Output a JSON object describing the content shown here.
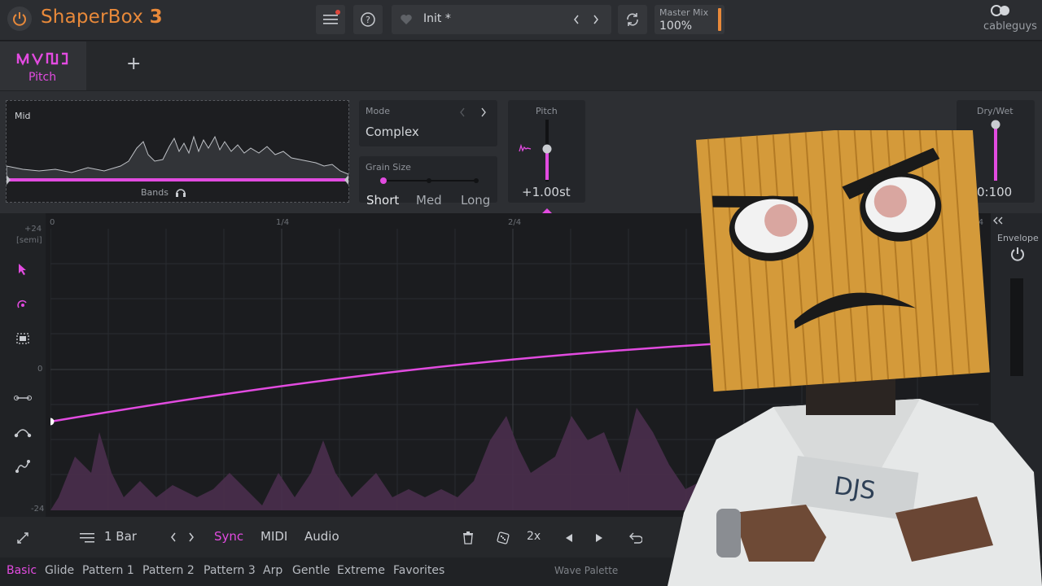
{
  "app": {
    "brand_name": "ShaperBox",
    "brand_version": "3",
    "vendor": "cableguys"
  },
  "topbar": {
    "preset_name": "Init *",
    "master_mix_label": "Master Mix",
    "master_mix_value": "100%"
  },
  "tabs": [
    {
      "label": "Pitch",
      "active": true
    }
  ],
  "analyzer": {
    "label": "Mid",
    "bands_label": "Bands"
  },
  "mode": {
    "label": "Mode",
    "value": "Complex"
  },
  "grain_size": {
    "label": "Grain Size",
    "options": [
      "Short",
      "Med",
      "Long"
    ],
    "selected": "Short"
  },
  "pitch": {
    "label": "Pitch",
    "value": "+1.00st",
    "level": 0.52
  },
  "dry_wet": {
    "label": "Dry/Wet",
    "value": "0:100",
    "level": 1.0
  },
  "editor": {
    "y_labels": [
      "+24",
      "[semi]",
      "0",
      "-24"
    ],
    "x_labels": [
      "0",
      "1/4",
      "2/4",
      "4/4"
    ],
    "envelope_label": "Envelope"
  },
  "bottombar": {
    "length": "1 Bar",
    "sync": "Sync",
    "midi": "MIDI",
    "audio": "Audio",
    "multiplier": "2x"
  },
  "presets": {
    "items": [
      "Basic",
      "Glide",
      "Pattern 1",
      "Pattern 2",
      "Pattern 3",
      "Arp",
      "Gentle",
      "Extreme",
      "Favorites"
    ],
    "active": "Basic",
    "wave_palette": "Wave Palette"
  },
  "colors": {
    "accent": "#e24be0",
    "brand": "#e8893a"
  }
}
